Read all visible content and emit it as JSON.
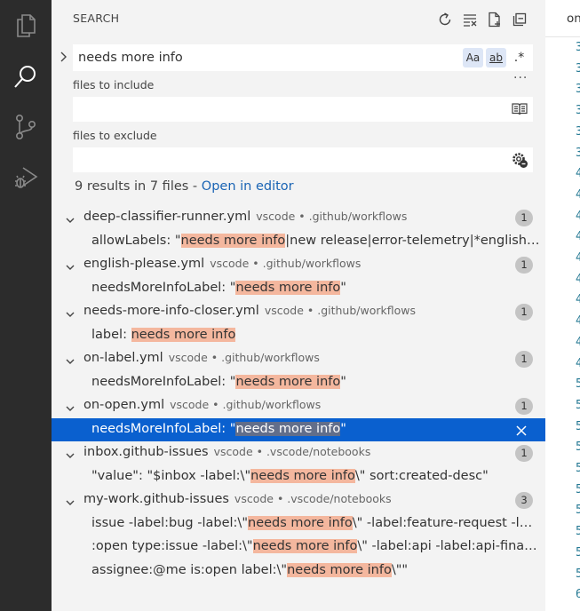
{
  "activity": {
    "items": [
      "explorer-icon",
      "search-icon",
      "source-control-icon",
      "run-debug-icon"
    ],
    "active": "search-icon",
    "colors": {
      "bg": "#2c2c2c",
      "icon": "#8a8a8a",
      "active_icon": "#ffffff"
    }
  },
  "sidebar": {
    "title": "SEARCH",
    "search": {
      "value": "needs more info",
      "options": {
        "match_case": "Aa",
        "whole_word": "ab",
        "regex": ".*"
      }
    },
    "include": {
      "label": "files to include",
      "value": ""
    },
    "exclude": {
      "label": "files to exclude",
      "value": ""
    },
    "summary": {
      "text": "9 results in 7 files - ",
      "link": "Open in editor"
    },
    "files": [
      {
        "name": "deep-classifier-runner.yml",
        "path": "vscode • .github/workflows",
        "count": "1",
        "matches": [
          {
            "before": "allowLabels: \"",
            "hit": "needs more info",
            "after": "|new release|error-telemetry|*english-please|translation-requir"
          }
        ]
      },
      {
        "name": "english-please.yml",
        "path": "vscode • .github/workflows",
        "count": "1",
        "matches": [
          {
            "before": "needsMoreInfoLabel: \"",
            "hit": "needs more info",
            "after": "\""
          }
        ]
      },
      {
        "name": "needs-more-info-closer.yml",
        "path": "vscode • .github/workflows",
        "count": "1",
        "matches": [
          {
            "before": "label: ",
            "hit": "needs more info",
            "after": ""
          }
        ]
      },
      {
        "name": "on-label.yml",
        "path": "vscode • .github/workflows",
        "count": "1",
        "matches": [
          {
            "before": "needsMoreInfoLabel: \"",
            "hit": "needs more info",
            "after": "\""
          }
        ]
      },
      {
        "name": "on-open.yml",
        "path": "vscode • .github/workflows",
        "count": "1",
        "matches": [
          {
            "before": "needsMoreInfoLabel: \"",
            "hit": "needs more info",
            "after": "\"",
            "selected": true
          }
        ]
      },
      {
        "name": "inbox.github-issues",
        "path": "vscode • .vscode/notebooks",
        "count": "1",
        "matches": [
          {
            "before": "\"value\": \"$inbox -label:\\\"",
            "hit": "needs more info",
            "after": "\\\" sort:created-desc\""
          }
        ]
      },
      {
        "name": "my-work.github-issues",
        "path": "vscode • .vscode/notebooks",
        "count": "3",
        "matches": [
          {
            "before": "issue -label:bug -label:\\\"",
            "hit": "needs more info",
            "after": "\\\" -label:feature-request -label:under-discussion"
          },
          {
            "before": ":open type:issue -label:\\\"",
            "hit": "needs more info",
            "after": "\\\" -label:api -label:api-finalization -label:api-propo"
          },
          {
            "before": "assignee:@me is:open label:\\\"",
            "hit": "needs more info",
            "after": "\\\"\""
          }
        ]
      }
    ],
    "colors": {
      "highlight": "#f4b79e",
      "selected_row": "#0a60cf",
      "badge": "#c4c4c4",
      "link": "#1a64b4"
    }
  },
  "editor": {
    "tab_label": "on",
    "line_numbers": [
      "3",
      "3",
      "3",
      "3",
      "3",
      "3",
      "4",
      "4",
      "4",
      "4",
      "4",
      "4",
      "4",
      "4",
      "4",
      "4",
      "5",
      "5",
      "5",
      "5",
      "5",
      "5",
      "5",
      "5",
      "5",
      "5",
      "6"
    ]
  }
}
